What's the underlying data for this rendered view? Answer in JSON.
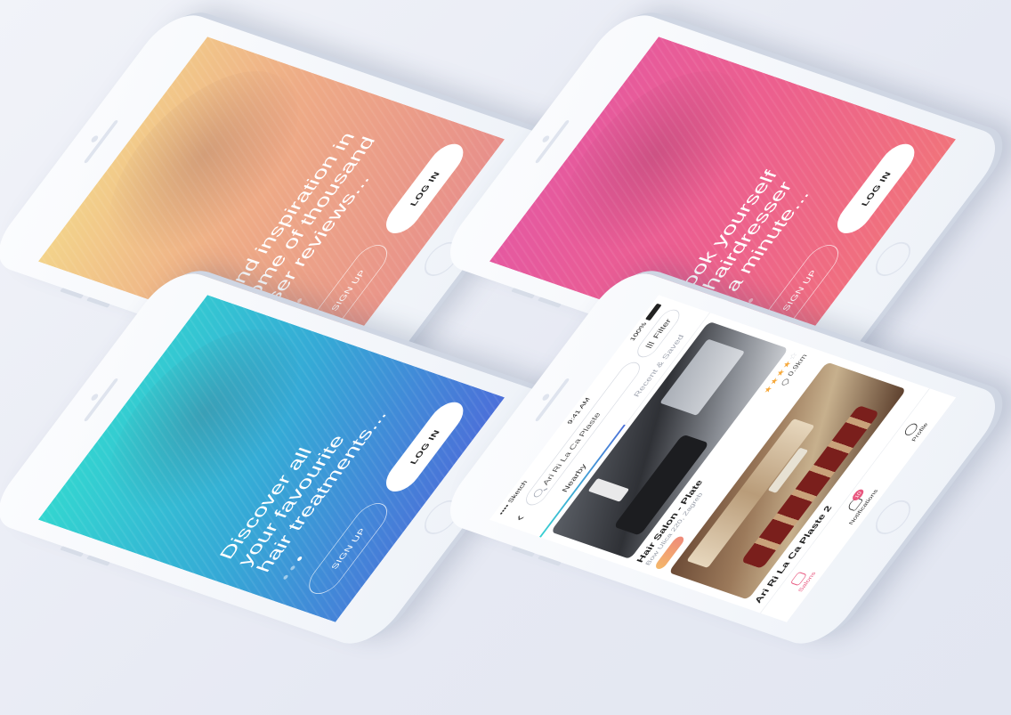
{
  "onboarding": [
    {
      "title": "Find inspiration in\nsome of thousand\nuser reviews...",
      "signup_label": "SIGN UP",
      "login_label": "LOG IN"
    },
    {
      "title": "Book yourself\na hairdresser\nin a minute...",
      "signup_label": "SIGN UP",
      "login_label": "LOG IN"
    },
    {
      "title": "Discover all\nyour favourite\nhair treatments...",
      "signup_label": "SIGN UP",
      "login_label": "LOG IN"
    }
  ],
  "explore": {
    "status": {
      "carrier": "•••• Sketch",
      "time": "9:41 AM",
      "battery": "100%"
    },
    "search": {
      "value": "Ari Ri La Ca Plaste"
    },
    "filter_label": "Filter",
    "tabs": [
      {
        "label": "Nearby"
      },
      {
        "label": "Recent & Saved"
      }
    ],
    "cards": [
      {
        "title": "Hair Salon - Plate",
        "address": "Bow Ulica 220, Zagreb",
        "stars_filled": "★★★★",
        "stars_empty": "☆",
        "distance": "0.9km"
      },
      {
        "title": "Ari Ri La Ca Plaste 2"
      }
    ],
    "nav": [
      {
        "label": "Salons"
      },
      {
        "label": "Notifications",
        "count": "10"
      },
      {
        "label": "Profile"
      }
    ]
  },
  "colors": {
    "peach_top": "#f3d38a",
    "peach_bottom": "#e88f8a",
    "pink_top": "#e559a0",
    "pink_bottom": "#f1737b",
    "teal_top": "#33d6d0",
    "teal_bottom": "#4c6fd9",
    "accent": "#e8577f",
    "background": "#e6e9f3"
  },
  "icons": [
    "back-icon",
    "search-icon",
    "filter-icon",
    "pin-icon",
    "home-icon",
    "bell-icon",
    "user-icon"
  ]
}
